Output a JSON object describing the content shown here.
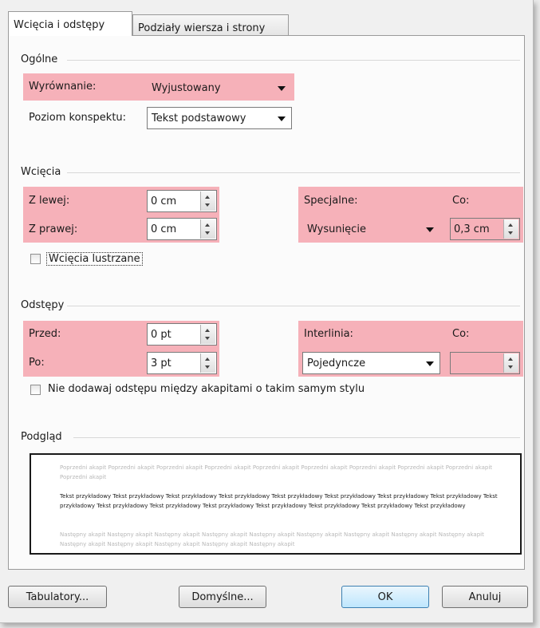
{
  "tabs": [
    {
      "label": "Wcięcia i odstępy"
    },
    {
      "label": "Podziały wiersza i strony"
    }
  ],
  "general": {
    "section": "Ogólne",
    "alignment_label": "Wyrównanie:",
    "alignment_value": "Wyjustowany",
    "outline_label": "Poziom konspektu:",
    "outline_value": "Tekst podstawowy"
  },
  "indent": {
    "section": "Wcięcia",
    "left_label": "Z lewej:",
    "left_value": "0 cm",
    "right_label": "Z prawej:",
    "right_value": "0 cm",
    "special_label": "Specjalne:",
    "special_value": "Wysunięcie",
    "by_label": "Co:",
    "by_value": "0,3 cm",
    "mirror_label": "Wcięcia lustrzane"
  },
  "spacing": {
    "section": "Odstępy",
    "before_label": "Przed:",
    "before_value": "0 pt",
    "after_label": "Po:",
    "after_value": "3 pt",
    "line_label": "Interlinia:",
    "line_value": "Pojedyncze",
    "at_label": "Co:",
    "at_value": "",
    "no_space_label": "Nie dodawaj odstępu między akapitami o takim samym stylu"
  },
  "preview": {
    "section": "Podgląd",
    "prev_text": "Poprzedni akapit Poprzedni akapit Poprzedni akapit Poprzedni akapit Poprzedni akapit Poprzedni akapit Poprzedni akapit Poprzedni akapit Poprzedni akapit Poprzedni akapit",
    "sample_text": "Tekst przykładowy Tekst przykładowy Tekst przykładowy Tekst przykładowy Tekst przykładowy Tekst przykładowy Tekst przykładowy Tekst przykładowy Tekst przykładowy Tekst przykładowy Tekst przykładowy Tekst przykładowy Tekst przykładowy Tekst przykładowy Tekst przykładowy Tekst przykładowy",
    "next_text": "Następny akapit Następny akapit Następny akapit Następny akapit Następny akapit Następny akapit Następny akapit Następny akapit Następny akapit Następny akapit Następny akapit Następny akapit Następny akapit Następny akapit"
  },
  "buttons": {
    "tabs_label": "Tabulatory...",
    "default_label": "Domyślne...",
    "ok_label": "OK",
    "cancel_label": "Anuluj"
  },
  "colors": {
    "highlight": "#f5a3ad",
    "ok_button": "#bee6fd"
  }
}
